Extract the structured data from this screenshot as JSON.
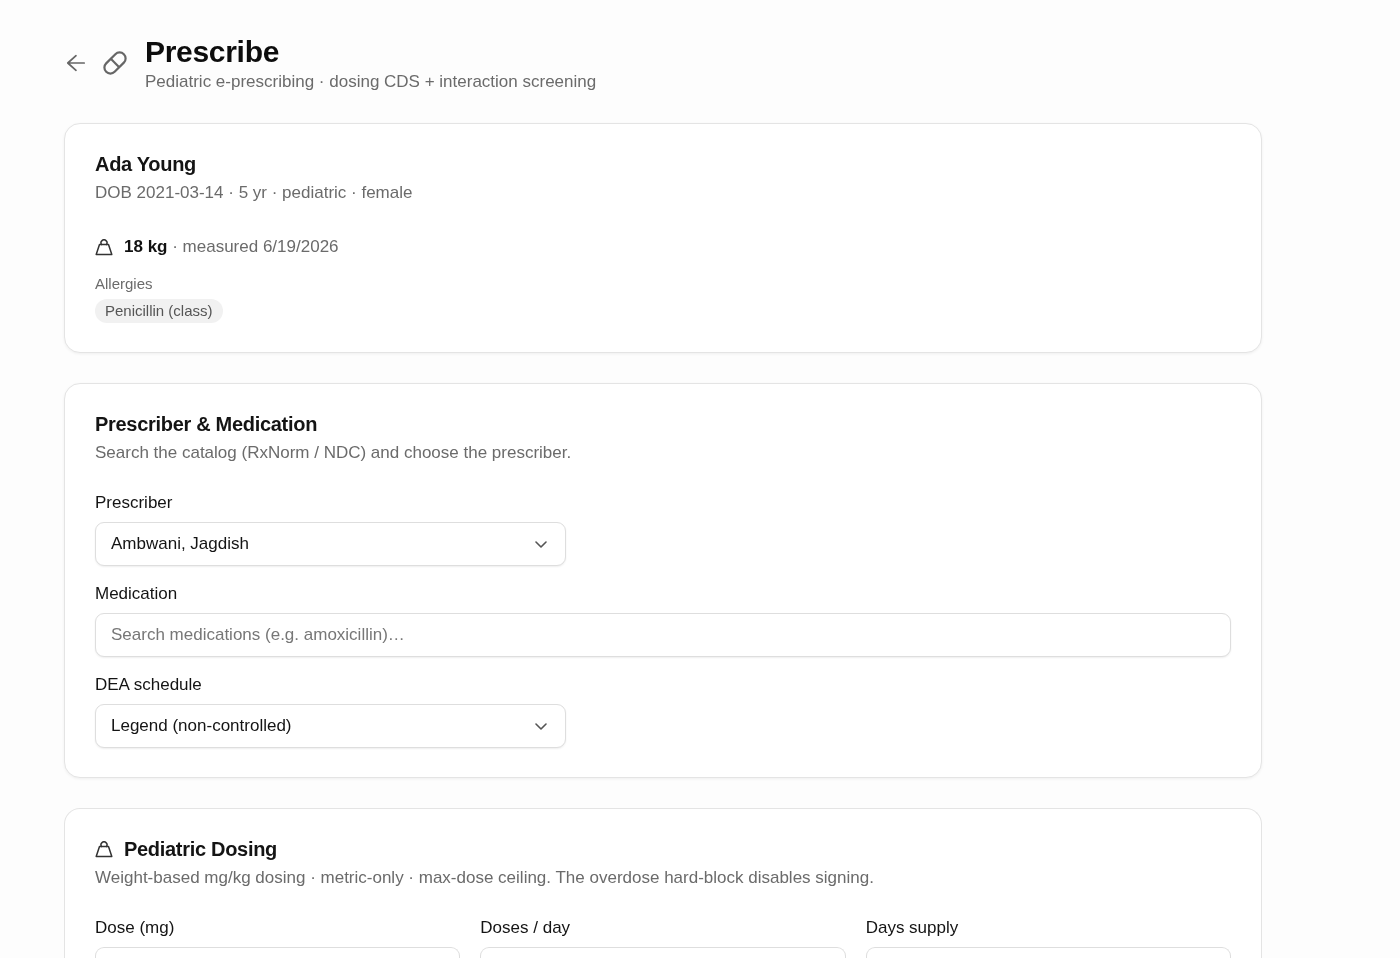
{
  "header": {
    "title": "Prescribe",
    "subtitle": "Pediatric e-prescribing · dosing CDS + interaction screening"
  },
  "patient": {
    "name": "Ada Young",
    "details": "DOB 2021-03-14 · 5 yr · pediatric · female",
    "weight": "**18 kg** · measured 6/19/2026",
    "allergies_label": "Allergies",
    "allergies": [
      "Penicillin (class)"
    ]
  },
  "prescriber_medication": {
    "title": "Prescriber & Medication",
    "description": "Search the catalog (RxNorm / NDC) and choose the prescriber.",
    "fields": [
      {
        "kind": "select",
        "label": "Prescriber",
        "value": "Ambwani, Jagdish"
      },
      {
        "kind": "search",
        "label": "Medication",
        "placeholder": "Search medications (e.g. amoxicillin)…"
      },
      {
        "kind": "select",
        "label": "DEA schedule",
        "value": "Legend (non-controlled)"
      }
    ]
  },
  "pediatric_dosing": {
    "title": "Pediatric Dosing",
    "description": "Weight-based mg/kg dosing · metric-only · max-dose ceiling. The overdose hard-block disables signing.",
    "fields": [
      {
        "label": "Dose (mg)"
      },
      {
        "label": "Doses / day"
      },
      {
        "label": "Days supply"
      }
    ]
  }
}
